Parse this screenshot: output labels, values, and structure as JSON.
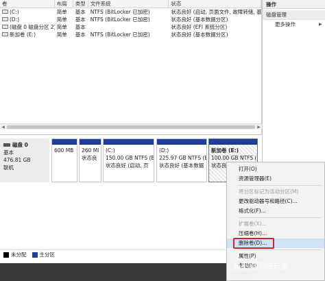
{
  "volumes": {
    "columns": [
      "卷",
      "布局",
      "类型",
      "文件系统",
      "状态"
    ],
    "rows": [
      {
        "name": "(C:)",
        "layout": "简单",
        "type": "基本",
        "fs": "NTFS (BitLocker 已加密)",
        "status": "状态良好 (启动, 页面文件, 故障转储, 基本"
      },
      {
        "name": "(D:)",
        "layout": "简单",
        "type": "基本",
        "fs": "NTFS (BitLocker 已加密)",
        "status": "状态良好 (基本数据分区)"
      },
      {
        "name": "(磁盘 0 磁盘分区 2)",
        "layout": "简单",
        "type": "基本",
        "fs": "",
        "status": "状态良好 (EFI 系统分区)"
      },
      {
        "name": "新加卷 (E:)",
        "layout": "简单",
        "type": "基本",
        "fs": "NTFS (BitLocker 已加密)",
        "status": "状态良好 (基本数据分区)"
      }
    ]
  },
  "ops": {
    "title": "操作",
    "section": "磁盘管理",
    "more": "更多操作"
  },
  "disk": {
    "name": "磁盘 0",
    "type": "基本",
    "size": "476.81 GB",
    "status": "联机",
    "partitions": [
      {
        "line1": "",
        "line2": "600 MB",
        "line3": ""
      },
      {
        "line1": "",
        "line2": "260 MI",
        "line3": "状态良"
      },
      {
        "line1": "(C:)",
        "line2": "150.00 GB NTFS (B",
        "line3": "状态良好 (启动, 页"
      },
      {
        "line1": "(D:)",
        "line2": "225.97 GB NTFS (B",
        "line3": "状态良好 (基本数据"
      },
      {
        "line1": "新加卷 (E:)",
        "line2": "100.00 GB NTFS (B",
        "line3": "状态良好 (基本数据"
      }
    ]
  },
  "legend": [
    {
      "label": "未分配",
      "color": "#000000"
    },
    {
      "label": "主分区",
      "color": "#1f3f9e"
    }
  ],
  "context_menu": {
    "items": [
      {
        "label": "打开(O)",
        "enabled": true
      },
      {
        "label": "资源管理器(E)",
        "enabled": true
      },
      {
        "label": "将分区标记为活动分区(M)",
        "enabled": false
      },
      {
        "label": "更改驱动器号和路径(C)...",
        "enabled": true
      },
      {
        "label": "格式化(F)...",
        "enabled": true
      },
      {
        "label": "扩展卷(X)...",
        "enabled": false
      },
      {
        "label": "压缩卷(H)...",
        "enabled": true
      },
      {
        "label": "删除卷(D)...",
        "enabled": true
      },
      {
        "label": "属性(P)",
        "enabled": true
      },
      {
        "label": "帮助(H)",
        "enabled": true
      }
    ]
  },
  "watermark": {
    "main": "知乎 @测峰玩家",
    "sub": "@测峰玩家"
  },
  "colors": {
    "primary_partition": "#1f3f9e",
    "highlight_box": "#d2212a",
    "menu_highlight": "#cfe3f7"
  }
}
